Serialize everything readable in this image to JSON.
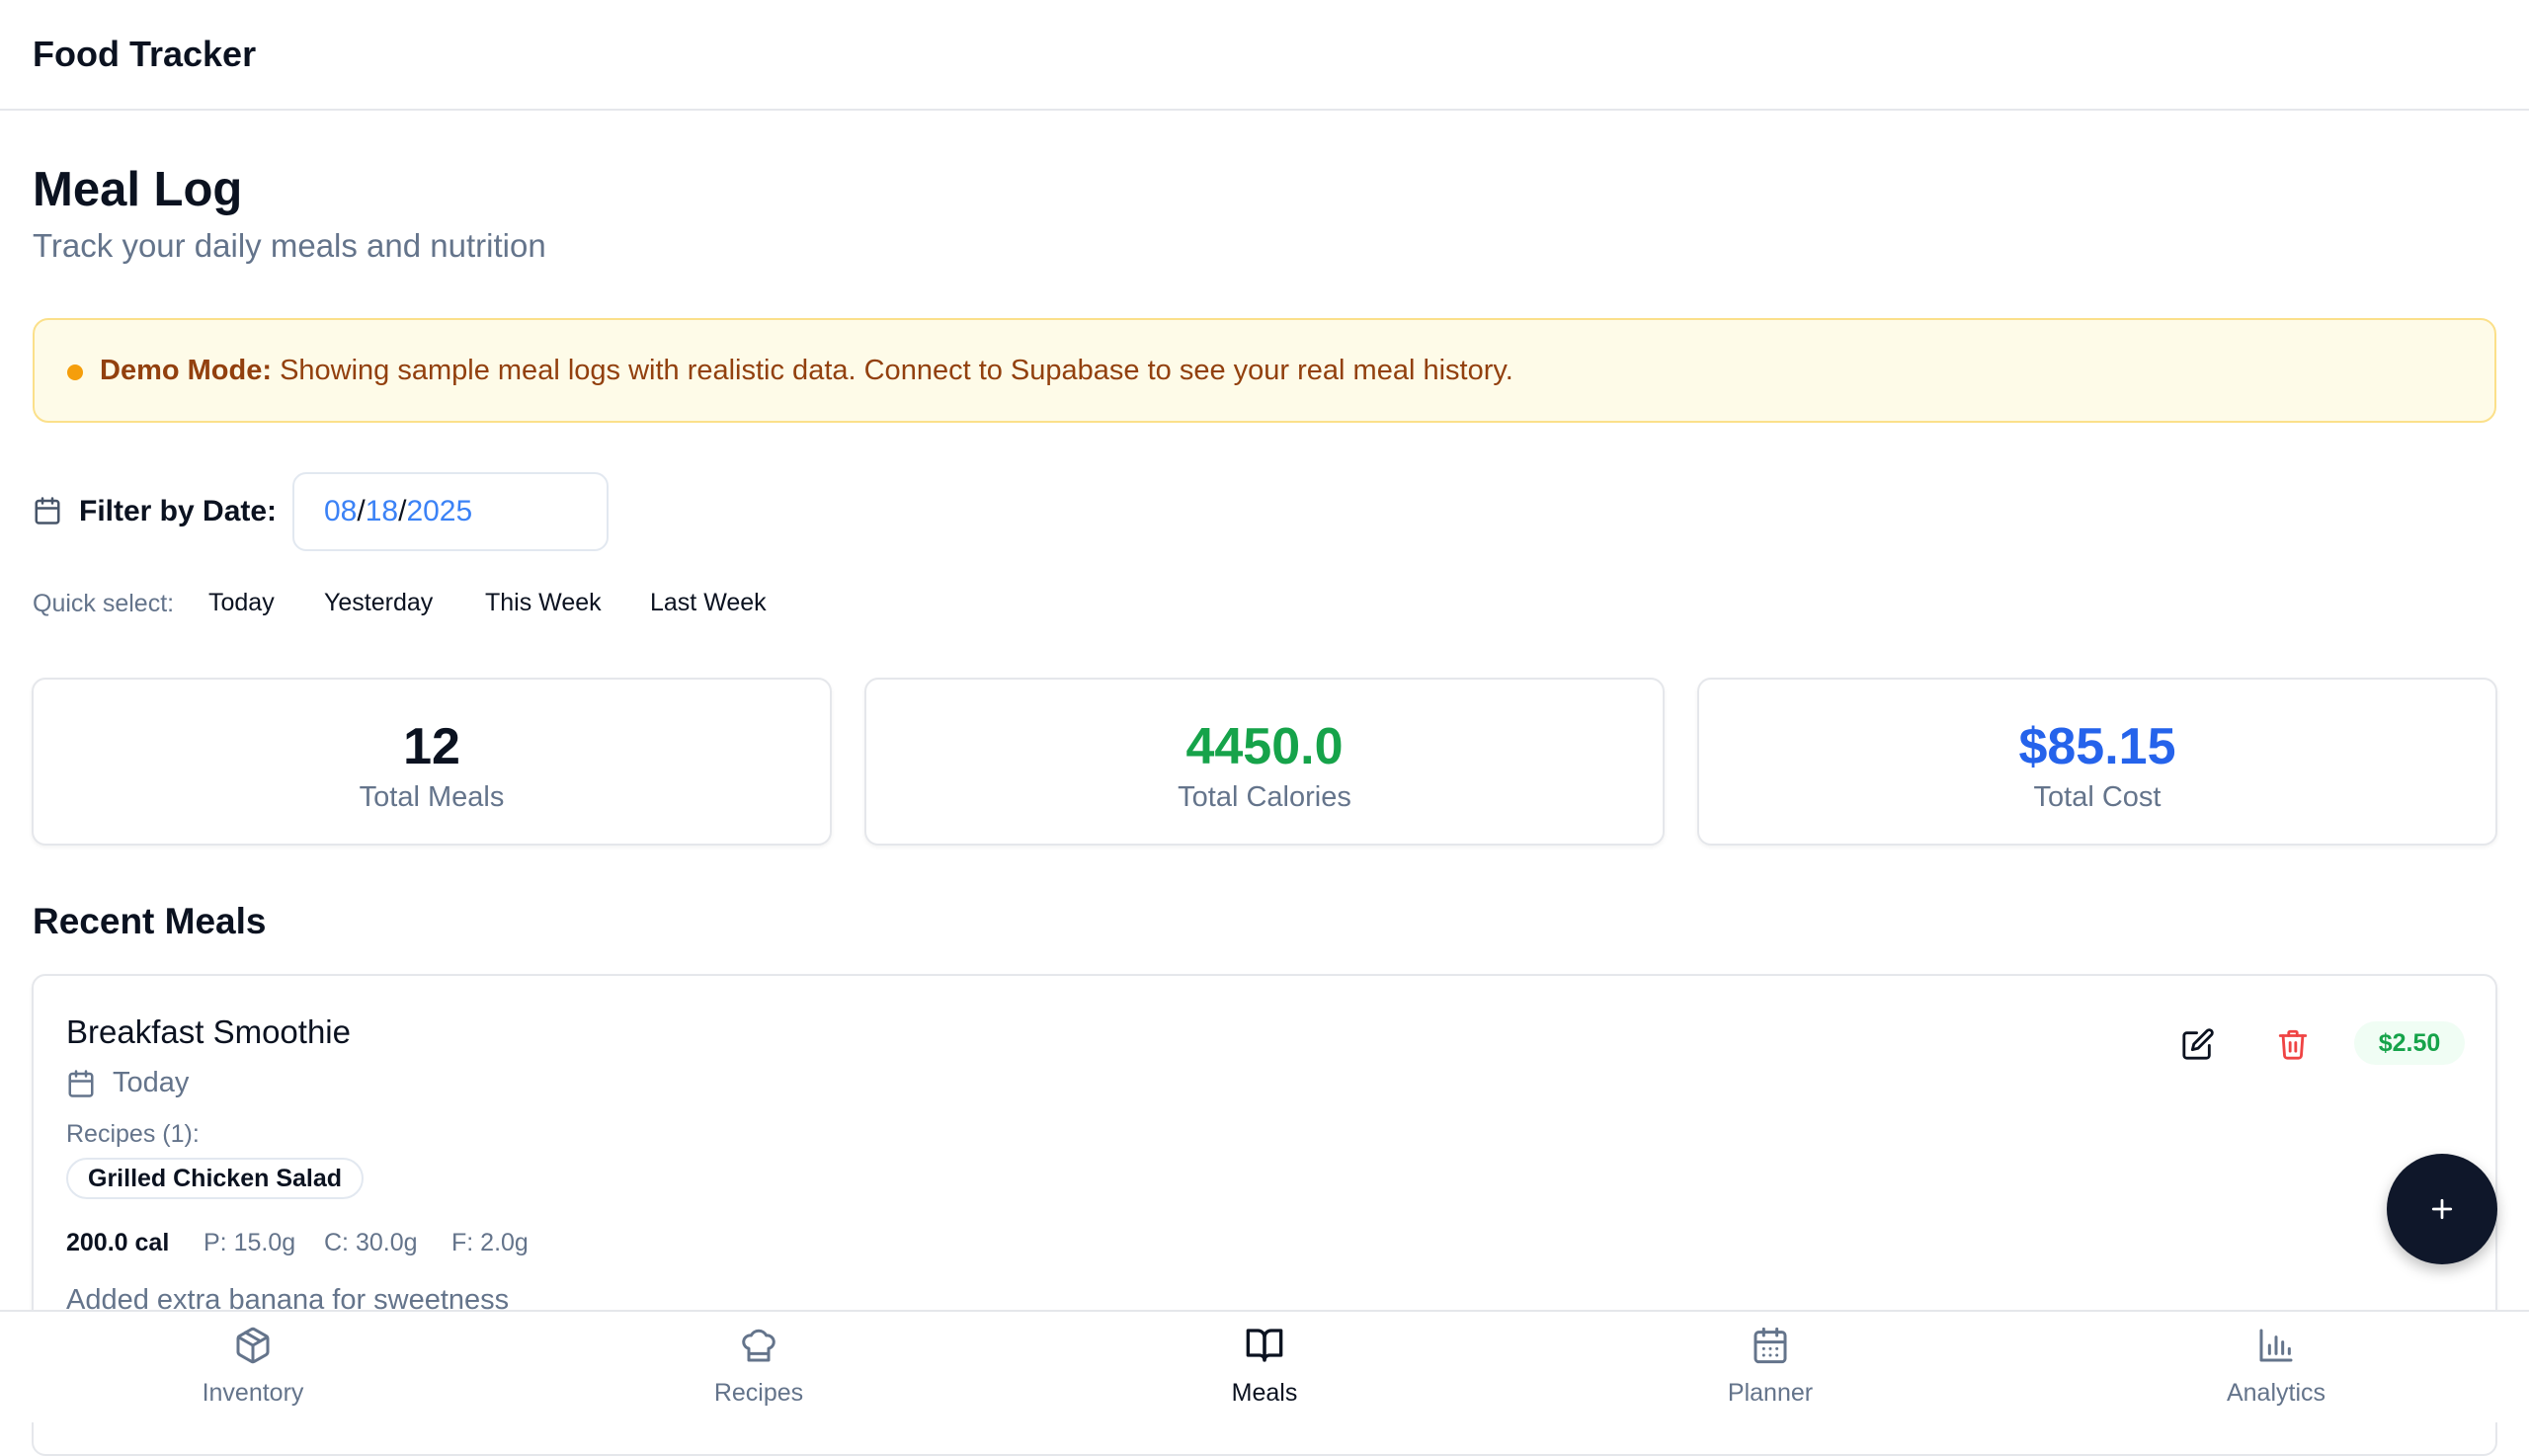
{
  "app": {
    "title": "Food Tracker"
  },
  "header": {
    "title": "Meal Log",
    "subtitle": "Track your daily meals and nutrition"
  },
  "banner": {
    "label": "Demo Mode:",
    "text": "Showing sample meal logs with realistic data. Connect to Supabase to see your real meal history."
  },
  "filter": {
    "label": "Filter by Date:",
    "date": {
      "month": "08",
      "day": "18",
      "year": "2025",
      "sep": "/"
    },
    "quick_label": "Quick select:",
    "quick": [
      "Today",
      "Yesterday",
      "This Week",
      "Last Week"
    ]
  },
  "stats": [
    {
      "value": "12",
      "label": "Total Meals",
      "color": "#0b1220"
    },
    {
      "value": "4450.0",
      "label": "Total Calories",
      "color": "#16a34a"
    },
    {
      "value": "$85.15",
      "label": "Total Cost",
      "color": "#2563eb"
    }
  ],
  "recent": {
    "title": "Recent Meals",
    "meals": [
      {
        "name": "Breakfast Smoothie",
        "date": "Today",
        "recipes_label": "Recipes (1):",
        "recipes": [
          "Grilled Chicken Salad"
        ],
        "calories": "200.0 cal",
        "protein": "P: 15.0g",
        "carbs": "C: 30.0g",
        "fat": "F: 2.0g",
        "note": "Added extra banana for sweetness",
        "cost": "$2.50"
      }
    ]
  },
  "nav": {
    "items": [
      {
        "label": "Inventory",
        "icon": "package-icon"
      },
      {
        "label": "Recipes",
        "icon": "chef-hat-icon"
      },
      {
        "label": "Meals",
        "icon": "book-open-icon"
      },
      {
        "label": "Planner",
        "icon": "calendar-icon"
      },
      {
        "label": "Analytics",
        "icon": "bar-chart-icon"
      }
    ],
    "active": "Meals"
  }
}
